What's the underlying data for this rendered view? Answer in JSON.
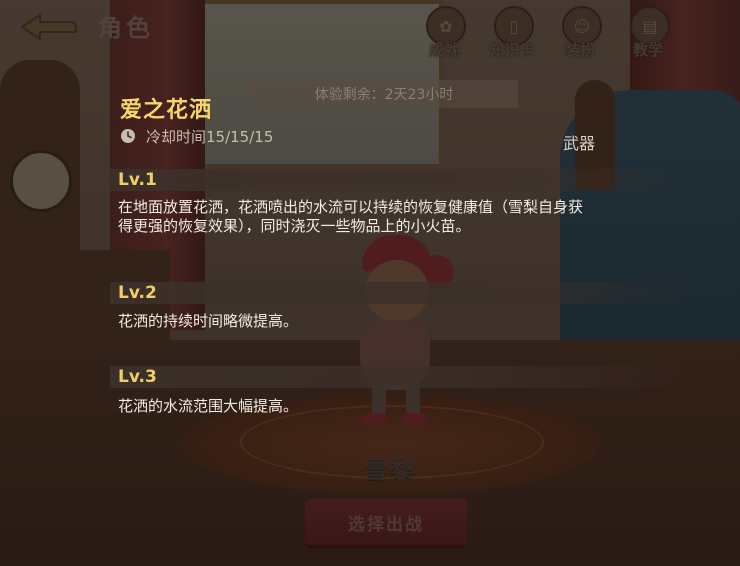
{
  "header": {
    "title": "角色",
    "buttons": [
      {
        "label": "成就",
        "icon": "achievement-icon"
      },
      {
        "label": "知识卡",
        "icon": "knowledge-card-icon"
      },
      {
        "label": "装扮",
        "icon": "outfit-icon"
      },
      {
        "label": "教学",
        "icon": "tutorial-icon"
      }
    ]
  },
  "trial": {
    "text": "体验剩余：2天23小时"
  },
  "skill": {
    "name": "爱之花洒",
    "cooldown": "冷却时间15/15/15",
    "category": "武器",
    "levels": [
      {
        "label": "Lv.1",
        "desc": "在地面放置花洒，花洒喷出的水流可以持续的恢复健康值（雪梨自身获得更强的恢复效果），同时浇灭一些物品上的小火苗。"
      },
      {
        "label": "Lv.2",
        "desc": "花洒的持续时间略微提高。"
      },
      {
        "label": "Lv.3",
        "desc": "花洒的水流范围大幅提高。"
      }
    ]
  },
  "character": {
    "name": "雪梨"
  },
  "action": {
    "select_label": "选择出战"
  },
  "colors": {
    "skill_title": "#f7d76a",
    "level_label": "#f2cf64",
    "desc_text": "#f2ece4"
  }
}
